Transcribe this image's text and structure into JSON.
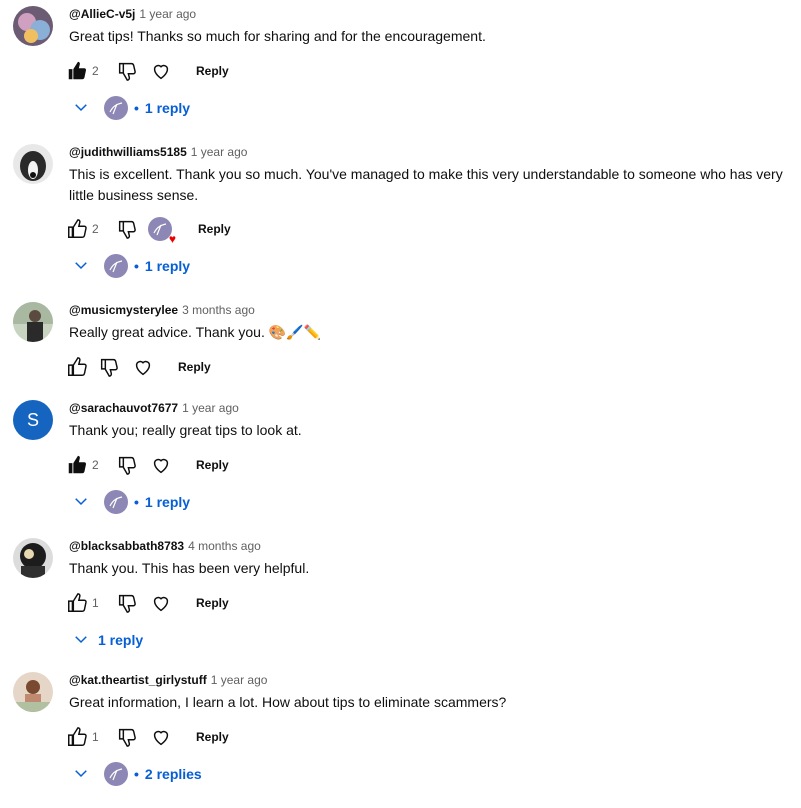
{
  "comments": [
    {
      "handle": "@AllieC-v5j",
      "time": "1 year ago",
      "text": "Great tips! Thanks so much for sharing and for the encouragement.",
      "likes": "2",
      "liked": true,
      "reply_label": "Reply",
      "replies": "1 reply",
      "avatar_color": "#6b5b73"
    },
    {
      "handle": "@judithwilliams5185",
      "time": "1 year ago",
      "text": "This is excellent. Thank you so much. You've managed to make this very understandable to someone who has very little business sense.",
      "likes": "2",
      "liked": false,
      "reply_label": "Reply",
      "replies": "1 reply",
      "avatar_color": "#9a9a9a"
    },
    {
      "handle": "@musicmysterylee",
      "time": "3 months ago",
      "text": "Really great advice. Thank you. 🎨🖌️✏️",
      "likes": "",
      "liked": false,
      "reply_label": "Reply",
      "replies": "",
      "avatar_color": "#7a8a70"
    },
    {
      "handle": "@sarachauvot7677",
      "time": "1 year ago",
      "text": "Thank you; really great tips to look at.",
      "likes": "2",
      "liked": true,
      "reply_label": "Reply",
      "replies": "1 reply",
      "avatar_letter": "S",
      "avatar_color": "#1565c0"
    },
    {
      "handle": "@blacksabbath8783",
      "time": "4 months ago",
      "text": "Thank you. This has been very helpful.",
      "likes": "1",
      "liked": false,
      "reply_label": "Reply",
      "replies": "1 reply",
      "avatar_color": "#3a3a3a"
    },
    {
      "handle": "@kat.theartist_girlystuff",
      "time": "1 year ago",
      "text": "Great information, I learn a lot. How about tips to eliminate scammers?",
      "likes": "1",
      "liked": false,
      "reply_label": "Reply",
      "replies": "2 replies",
      "avatar_color": "#b89a86"
    }
  ],
  "creator_color": "#8c87b4"
}
